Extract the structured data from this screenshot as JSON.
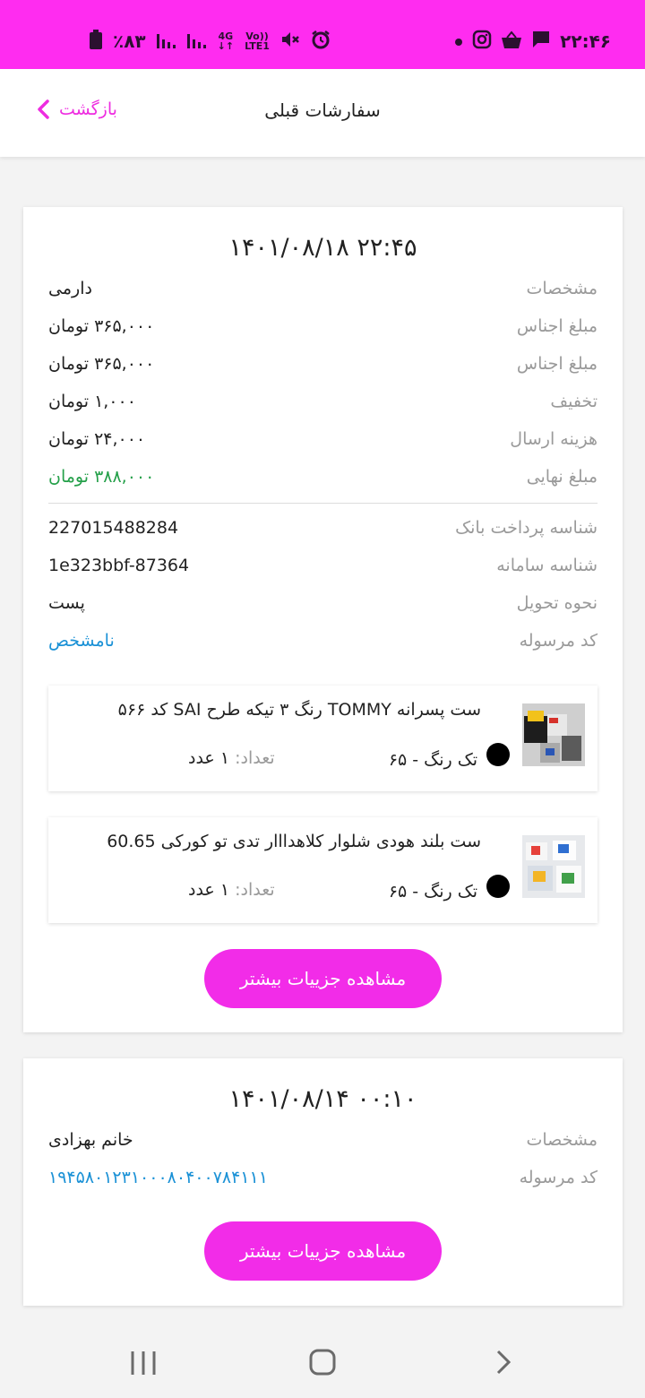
{
  "status_bar": {
    "time": "۲۲:۴۶",
    "battery": "٪۸۳",
    "network_top": "4G",
    "volte_top": "Vo))",
    "volte_bottom": "LTE1",
    "icons": [
      "dot-icon",
      "instagram-icon",
      "shopping-basket-icon",
      "message-icon",
      "alarm-icon",
      "mute-icon",
      "signal-icon",
      "signal-icon",
      "battery-icon"
    ]
  },
  "header": {
    "title": "سفارشات قبلی",
    "back_label": "بازگشت"
  },
  "orders": [
    {
      "date": "۱۴۰۱/۰۸/۱۸ ۲۲:۴۵",
      "rows": [
        {
          "label": "مشخصات",
          "value": "دارمی"
        },
        {
          "label": "مبلغ اجناس",
          "value": "۳۶۵,۰۰۰ تومان"
        },
        {
          "label": "مبلغ اجناس",
          "value": "۳۶۵,۰۰۰ تومان"
        },
        {
          "label": "تخفیف",
          "value": "۱,۰۰۰ تومان"
        },
        {
          "label": "هزینه ارسال",
          "value": "۲۴,۰۰۰ تومان"
        },
        {
          "label": "مبلغ نهایی",
          "value": "۳۸۸,۰۰۰ تومان"
        }
      ],
      "rows2": [
        {
          "label": "شناسه پرداخت بانک",
          "value": "227015488284"
        },
        {
          "label": "شناسه سامانه",
          "value": "1e323bbf-87364"
        },
        {
          "label": "نحوه تحویل",
          "value": "پست"
        },
        {
          "label": "کد مرسوله",
          "value": "نامشخص"
        }
      ],
      "products": [
        {
          "name": "ست پسرانه TOMMY رنگ ۳ تیکه طرح SAI کد ۵۶۶",
          "color": "تک رنگ - ۶۵",
          "qty_label": "تعداد:",
          "qty_value": "۱ عدد",
          "color_swatch": "#000000"
        },
        {
          "name": "ست بلند هودی شلوار کلاهدااار تدی تو کورکی 60.65",
          "color": "تک رنگ - ۶۵",
          "qty_label": "تعداد:",
          "qty_value": "۱ عدد",
          "color_swatch": "#000000"
        }
      ],
      "details_button": "مشاهده جزییات بیشتر"
    },
    {
      "date": "۱۴۰۱/۰۸/۱۴ ۰۰:۱۰",
      "rows": [
        {
          "label": "مشخصات",
          "value": "خانم بهزادی"
        },
        {
          "label": "کد مرسوله",
          "value": "۱۹۴۵۸۰۱۲۳۱۰۰۰۸۰۴۰۰۷۸۴۱۱۱"
        }
      ],
      "details_button": "مشاهده جزییات بیشتر"
    }
  ],
  "colors": {
    "accent": "#ff2cf0",
    "button": "#f22ce8",
    "final_price": "#25a04a",
    "tracking": "#1a91d6"
  },
  "nav_bar": {
    "icons": [
      "recent-apps-icon",
      "home-icon",
      "back-icon"
    ]
  }
}
